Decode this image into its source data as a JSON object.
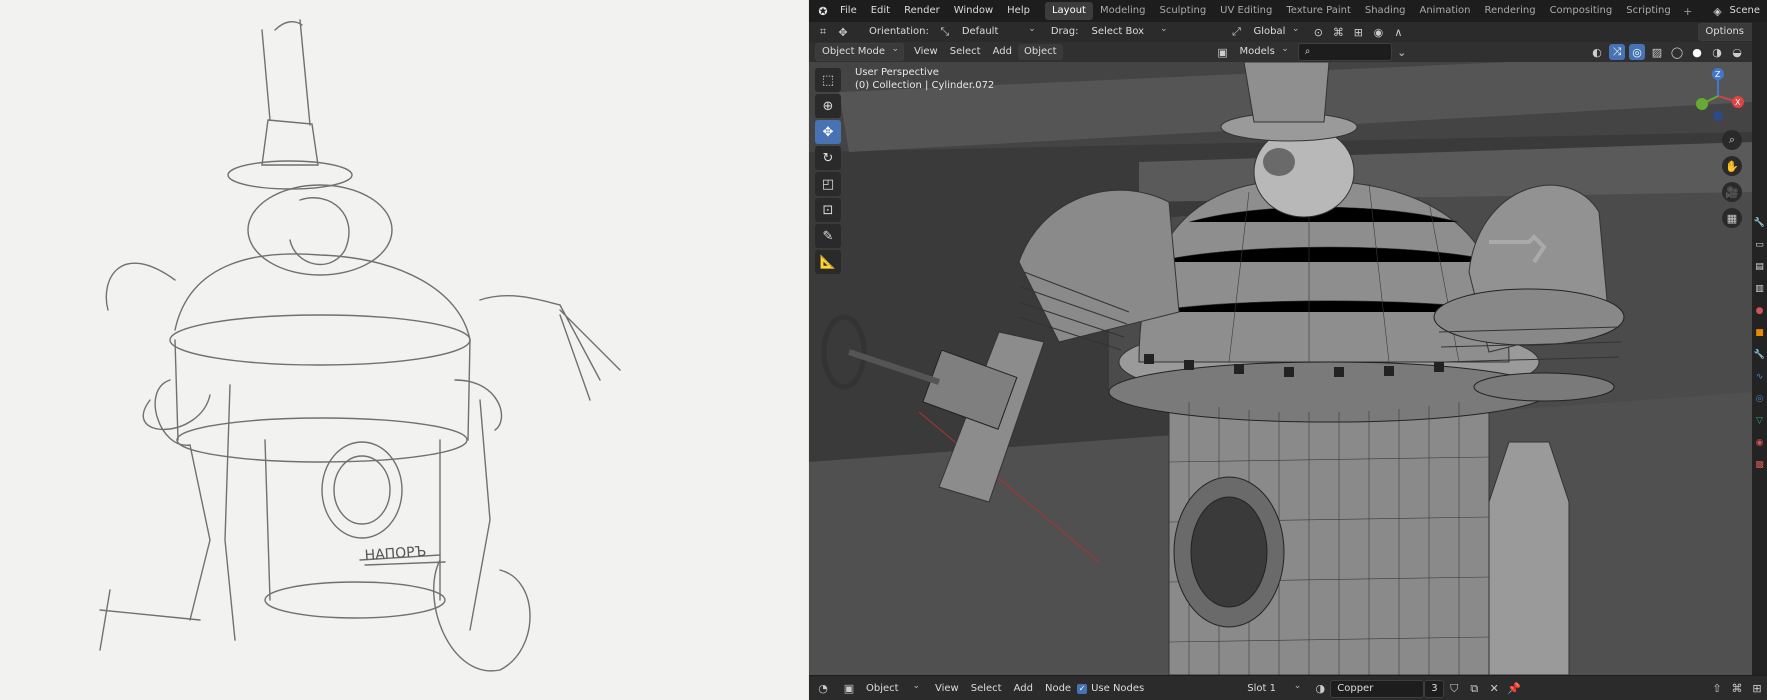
{
  "menu": {
    "items": [
      "File",
      "Edit",
      "Render",
      "Window",
      "Help"
    ]
  },
  "workspaces": [
    "Layout",
    "Modeling",
    "Sculpting",
    "UV Editing",
    "Texture Paint",
    "Shading",
    "Animation",
    "Rendering",
    "Compositing",
    "Scripting"
  ],
  "active_workspace": "Layout",
  "scene_label": "Scene",
  "header": {
    "orientation_label": "Orientation:",
    "orientation_value": "Default",
    "drag_label": "Drag:",
    "drag_value": "Select Box",
    "transform_orientation": "Global",
    "options_label": "Options"
  },
  "viewport_header": {
    "mode": "Object Mode",
    "menus": [
      "View",
      "Select",
      "Add",
      "Object"
    ],
    "collection_filter": "Models"
  },
  "viewport": {
    "perspective_label": "User Perspective",
    "collection_label": "(0) Collection | Cylinder.072"
  },
  "gizmo": {
    "x_label": "X",
    "y_label": "Y",
    "z_label": "Z"
  },
  "bottom": {
    "editor_type": "Object",
    "menus": [
      "View",
      "Select",
      "Add",
      "Node"
    ],
    "use_nodes_label": "Use Nodes",
    "slot": "Slot 1",
    "material": "Copper",
    "user_count": "3"
  },
  "colors": {
    "accent": "#4772b3",
    "bg_dark": "#1d1d1d",
    "viewport": "#3a3a3a"
  },
  "icons": [
    "blender-logo",
    "cursor-icon",
    "move-icon",
    "rotate-icon",
    "scale-icon",
    "transform-icon",
    "annotate-icon",
    "measure-icon",
    "zoom-icon",
    "hand-icon",
    "camera-icon",
    "grid-icon"
  ]
}
